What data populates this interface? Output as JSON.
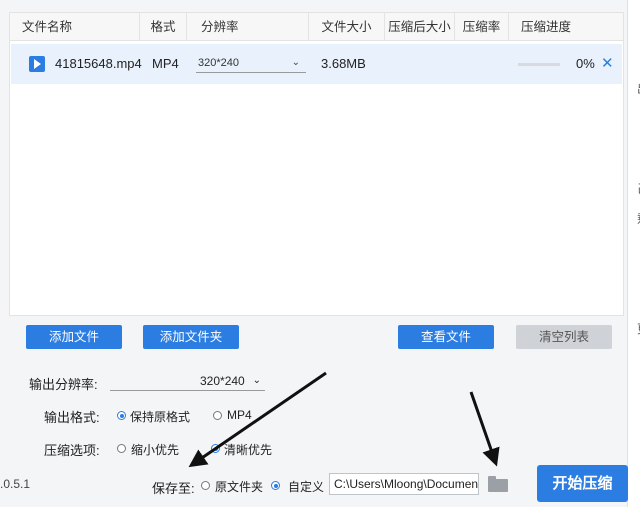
{
  "table": {
    "headers": [
      "文件名称",
      "格式",
      "分辨率",
      "文件大小",
      "压缩后大小",
      "压缩率",
      "压缩进度"
    ],
    "rows": [
      {
        "name": "41815648.mp4",
        "format": "MP4",
        "resolution": "320*240",
        "size": "3.68MB",
        "compressed_size": "",
        "ratio": "",
        "progress": "0%",
        "progress_value": 0
      }
    ]
  },
  "buttons": {
    "add_file": "添加文件",
    "add_folder": "添加文件夹",
    "view_files": "查看文件",
    "clear_list": "清空列表",
    "start": "开始压缩"
  },
  "settings": {
    "output_resolution_label": "输出分辨率:",
    "output_resolution_value": "320*240",
    "output_format_label": "输出格式:",
    "format_options": [
      "保持原格式",
      "MP4"
    ],
    "format_selected": "保持原格式",
    "compress_label": "压缩选项:",
    "compress_options": [
      "缩小优先",
      "清晰优先"
    ],
    "compress_selected": "清晰优先",
    "save_to_label": "保存至:",
    "save_options": [
      "原文件夹",
      "自定义"
    ],
    "save_selected": "自定义",
    "save_path": "C:\\Users\\Mloong\\Documents"
  },
  "footer": {
    "version": ".0.5.1"
  },
  "icons": {
    "file": "video-file-icon",
    "row_remove": "close-icon",
    "chevron": "chevron-down-icon",
    "folder": "folder-icon"
  },
  "colors": {
    "accent": "#2b7de1",
    "row_highlight": "#e9f2fc",
    "disabled_button": "#cfd2d6"
  }
}
